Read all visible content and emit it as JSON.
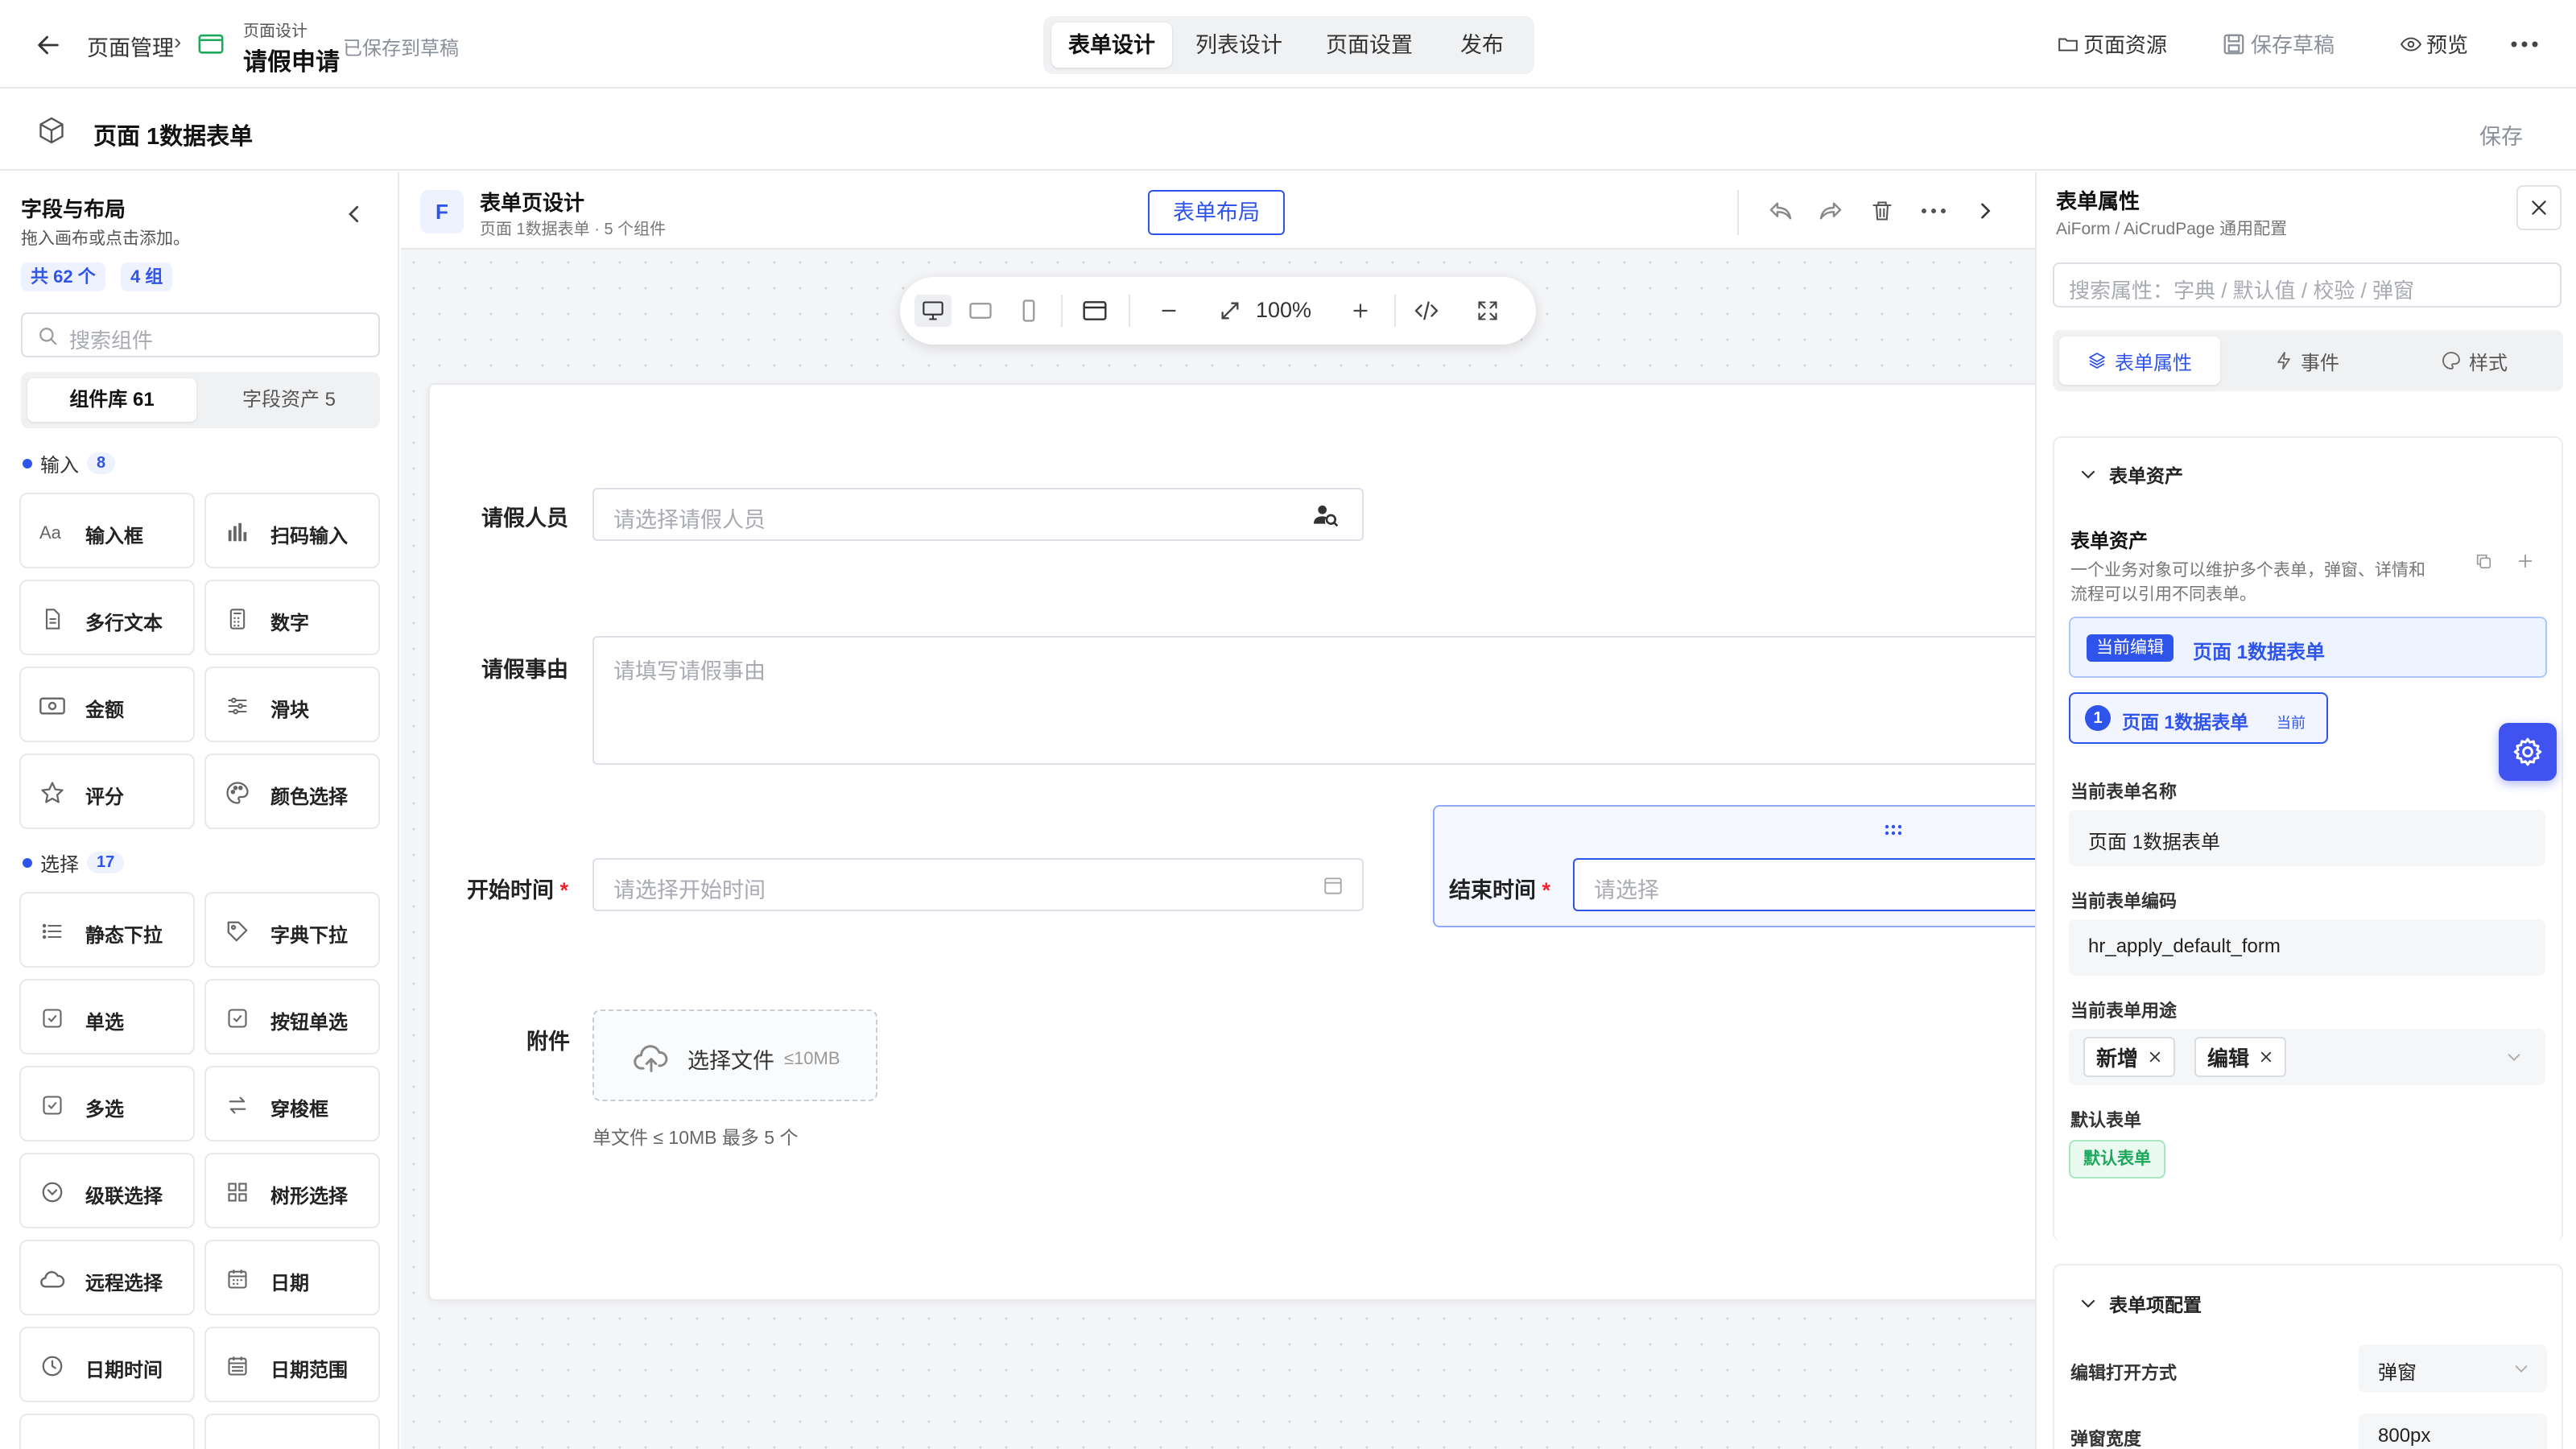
{
  "topbar": {
    "crumb_root": "页面管理",
    "crumb_sep": "›",
    "page_kind": "页面设计",
    "page_name": "请假申请",
    "saved_status": "已保存到草稿",
    "tabs": [
      {
        "label": "表单设计",
        "active": true
      },
      {
        "label": "列表设计",
        "active": false
      },
      {
        "label": "页面设置",
        "active": false
      },
      {
        "label": "发布",
        "active": false
      }
    ],
    "resources_label": "页面资源",
    "save_draft_label": "保存草稿",
    "preview_label": "预览"
  },
  "subbar": {
    "title": "页面 1数据表单",
    "save_label": "保存"
  },
  "left_panel": {
    "title": "字段与布局",
    "subtitle": "拖入画布或点击添加。",
    "total_badge": "共 62 个",
    "group_badge": "4 组",
    "search_placeholder": "搜索组件",
    "tabs": [
      {
        "label": "组件库 61",
        "active": true
      },
      {
        "label": "字段资产 5",
        "active": false
      }
    ],
    "groups": [
      {
        "name": "输入",
        "count": "8",
        "items": [
          {
            "label": "输入框",
            "icon": "text-aa-icon"
          },
          {
            "label": "扫码输入",
            "icon": "barcode-icon"
          },
          {
            "label": "多行文本",
            "icon": "document-icon"
          },
          {
            "label": "数字",
            "icon": "calculator-icon"
          },
          {
            "label": "金额",
            "icon": "banknote-icon"
          },
          {
            "label": "滑块",
            "icon": "sliders-icon"
          },
          {
            "label": "评分",
            "icon": "star-icon"
          },
          {
            "label": "颜色选择",
            "icon": "palette-icon"
          }
        ]
      },
      {
        "name": "选择",
        "count": "17",
        "items": [
          {
            "label": "静态下拉",
            "icon": "list-icon"
          },
          {
            "label": "字典下拉",
            "icon": "tag-icon"
          },
          {
            "label": "单选",
            "icon": "checkbox-icon"
          },
          {
            "label": "按钮单选",
            "icon": "checkbox-icon"
          },
          {
            "label": "多选",
            "icon": "checkbox-icon"
          },
          {
            "label": "穿梭框",
            "icon": "transfer-icon"
          },
          {
            "label": "级联选择",
            "icon": "chevron-circle-icon"
          },
          {
            "label": "树形选择",
            "icon": "grid-icon"
          },
          {
            "label": "远程选择",
            "icon": "cloud-icon"
          },
          {
            "label": "日期",
            "icon": "calendar-icon"
          },
          {
            "label": "日期时间",
            "icon": "clock-icon"
          },
          {
            "label": "日期范围",
            "icon": "calendar-range-icon"
          }
        ]
      }
    ]
  },
  "canvas": {
    "badge_letter": "F",
    "title": "表单页设计",
    "subtitle": "页面 1数据表单 · 5 个组件",
    "layout_button": "表单布局",
    "zoom": "100%",
    "form": {
      "applicant_label": "请假人员",
      "applicant_placeholder": "请选择请假人员",
      "reason_label": "请假事由",
      "reason_placeholder": "请填写请假事由",
      "start_label": "开始时间",
      "start_placeholder": "请选择开始时间",
      "end_label": "结束时间",
      "end_placeholder": "请选择",
      "required_mark": "*",
      "attach_label": "附件",
      "upload_label": "选择文件",
      "upload_limit": "≤10MB",
      "upload_hint": "单文件 ≤ 10MB 最多 5 个"
    }
  },
  "right_panel": {
    "title": "表单属性",
    "subtitle": "AiForm / AiCrudPage 通用配置",
    "search_placeholder": "搜索属性：字典 / 默认值 / 校验 / 弹窗",
    "tabs": [
      {
        "label": "表单属性",
        "active": true,
        "icon": "layers-icon"
      },
      {
        "label": "事件",
        "active": false,
        "icon": "lightning-icon"
      },
      {
        "label": "样式",
        "active": false,
        "icon": "palette-icon"
      }
    ],
    "assets_section": "表单资产",
    "assets_title": "表单资产",
    "assets_desc_1": "一个业务对象可以维护多个表单，弹窗、详情和",
    "assets_desc_2": "流程可以引用不同表单。",
    "current_editing_tag": "当前编辑",
    "current_form_name": "页面 1数据表单",
    "item_number": "1",
    "item_name": "页面 1数据表单",
    "item_current_tag": "当前",
    "name_label": "当前表单名称",
    "name_value": "页面 1数据表单",
    "code_label": "当前表单编码",
    "code_value": "hr_apply_default_form",
    "usage_label": "当前表单用途",
    "usage_tags": [
      "新增",
      "编辑"
    ],
    "default_label": "默认表单",
    "default_tag": "默认表单",
    "items_section": "表单项配置",
    "open_mode_label": "编辑打开方式",
    "open_mode_value": "弹窗",
    "width_label": "弹窗宽度",
    "width_value": "800px"
  },
  "colors": {
    "accent": "#2f54eb",
    "gear_bg": "#4052f0",
    "success": "#1ca85b",
    "required": "#f5222d"
  }
}
